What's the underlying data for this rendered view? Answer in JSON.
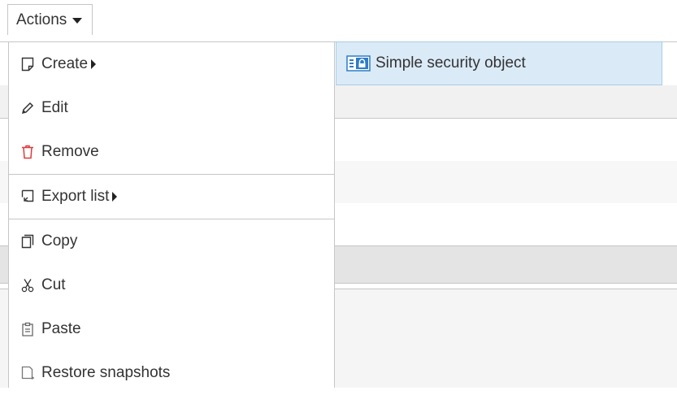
{
  "actions_button": {
    "label": "Actions"
  },
  "menu": {
    "create": "Create",
    "edit": "Edit",
    "remove": "Remove",
    "export_list": "Export list",
    "copy": "Copy",
    "cut": "Cut",
    "paste": "Paste",
    "restore_snapshots": "Restore snapshots"
  },
  "submenu": {
    "simple_security_object": "Simple security object"
  },
  "colors": {
    "submenu_highlight": "#dbeaf7",
    "remove_icon": "#e03a3a",
    "security_icon": "#2e7cc9"
  }
}
